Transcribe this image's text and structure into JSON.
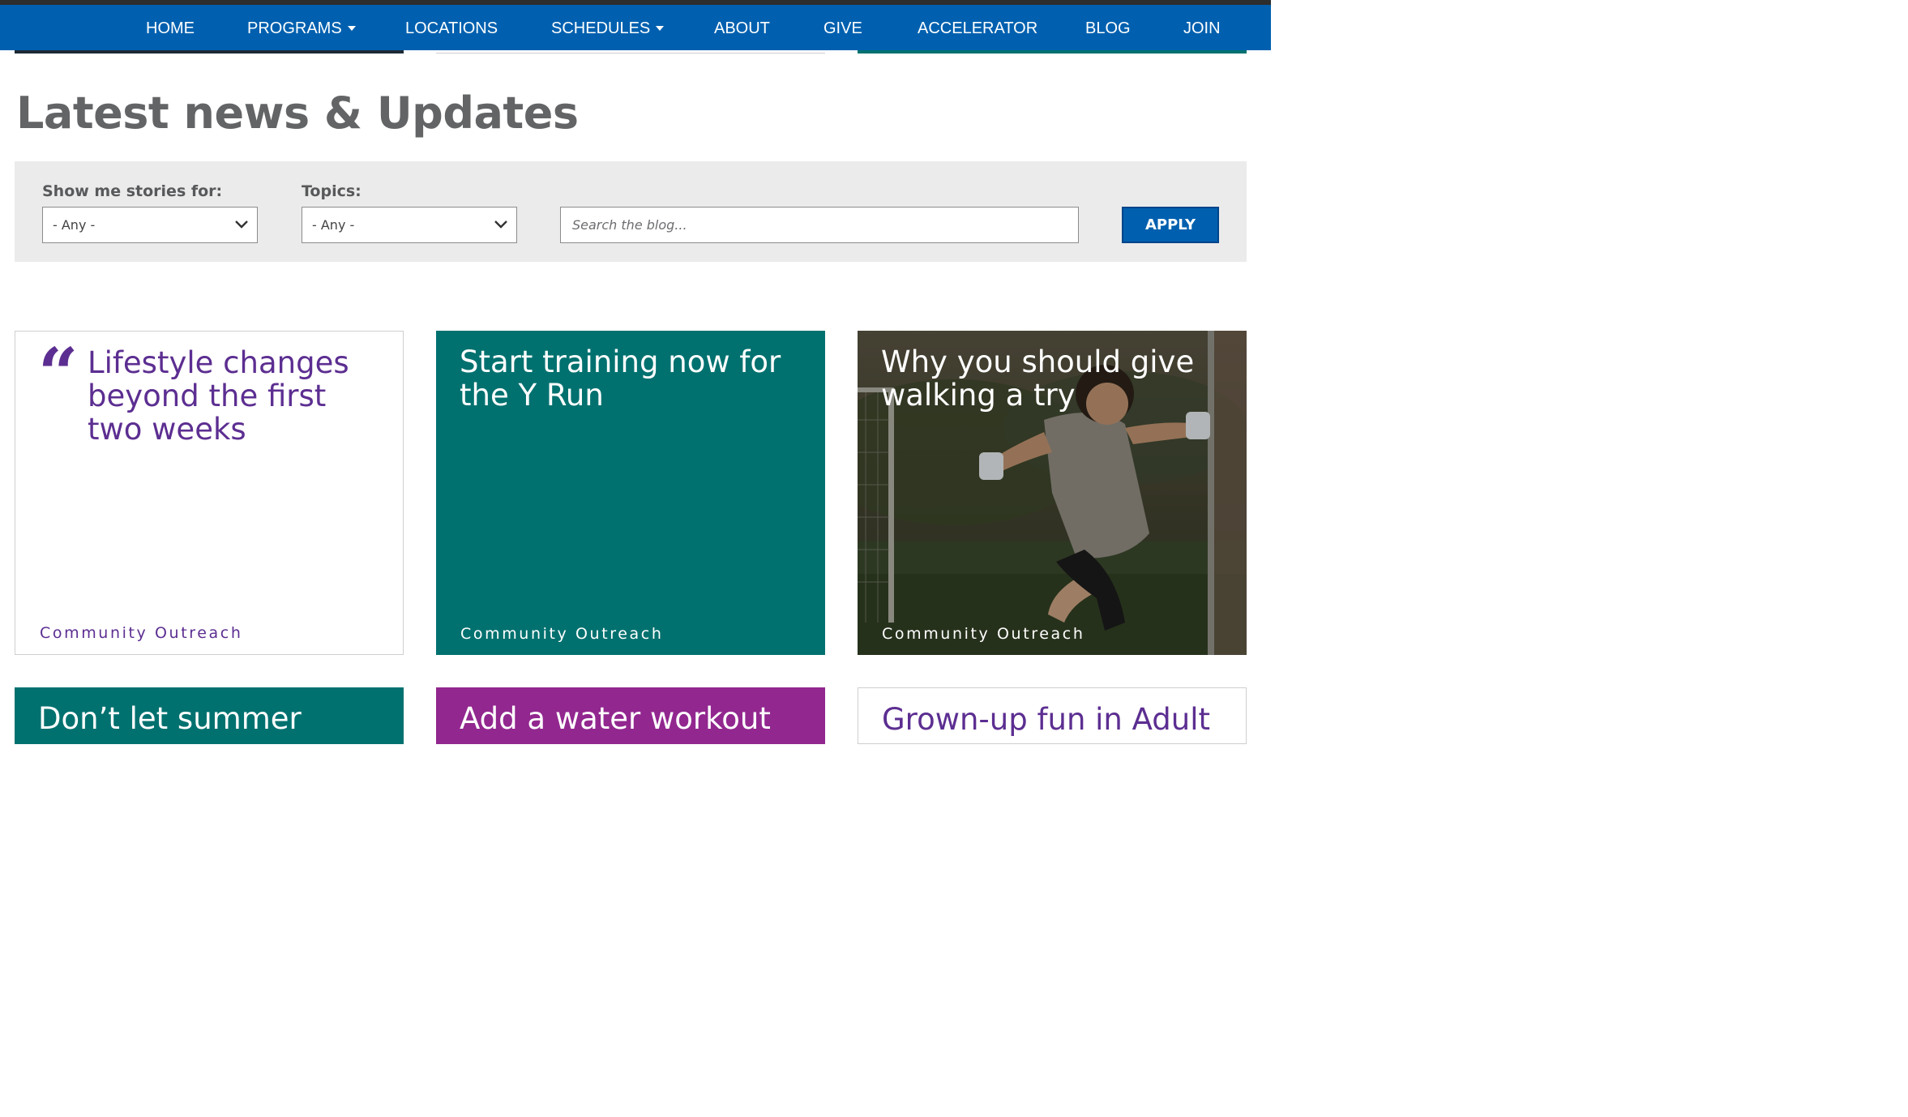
{
  "nav": {
    "items": [
      {
        "label": "HOME"
      },
      {
        "label": "PROGRAMS"
      },
      {
        "label": "LOCATIONS"
      },
      {
        "label": "SCHEDULES"
      },
      {
        "label": "ABOUT"
      },
      {
        "label": "GIVE"
      },
      {
        "label": "ACCELERATOR"
      },
      {
        "label": "BLOG"
      },
      {
        "label": "JOIN"
      }
    ]
  },
  "page": {
    "heading": "Latest news & Updates"
  },
  "filters": {
    "stories_label": "Show me stories for:",
    "stories_value": "- Any -",
    "topics_label": "Topics:",
    "topics_value": "- Any -",
    "search_placeholder": "Search the blog...",
    "apply_label": "APPLY"
  },
  "cards": [
    {
      "title": "Lifestyle changes beyond the first two weeks",
      "category": "Community Outreach",
      "quote_mark": "“"
    },
    {
      "title": "Start training now for the Y Run",
      "category": "Community Outreach"
    },
    {
      "title": "Why you should give walking a try",
      "category": "Community Outreach"
    },
    {
      "title": "Don’t let summer"
    },
    {
      "title": "Add a water workout"
    },
    {
      "title": "Grown-up fun in Adult"
    }
  ],
  "colors": {
    "nav_blue": "#0060af",
    "teal": "#01716f",
    "purple": "#92278f",
    "title_purple": "#5c2e91"
  }
}
